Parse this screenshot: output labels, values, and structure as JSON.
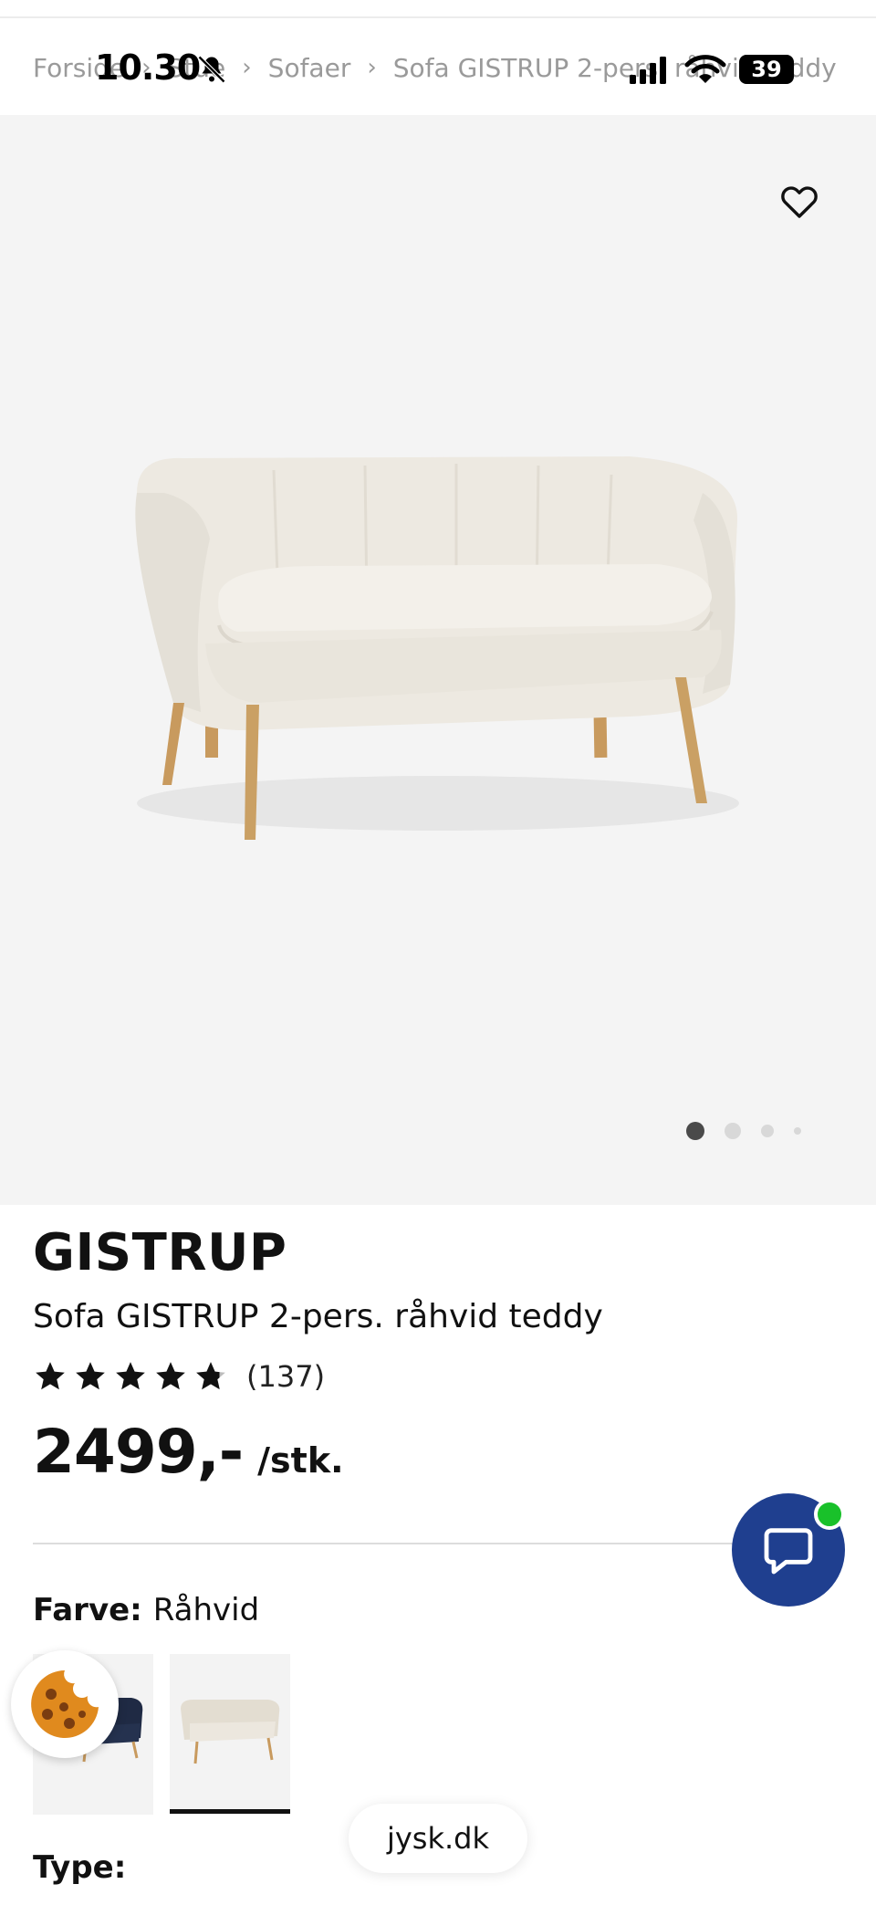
{
  "status_bar": {
    "time": "10.30",
    "battery": "39"
  },
  "breadcrumb": {
    "items": [
      "Forside",
      "Stue",
      "Sofaer",
      "Sofa GISTRUP 2-pers. råhvid teddy"
    ],
    "separator": "›"
  },
  "gallery": {
    "favorite_icon": "heart-outline-icon",
    "dots": 4,
    "active_dot": 0
  },
  "product": {
    "brand": "GISTRUP",
    "name": "Sofa GISTRUP 2-pers. råhvid teddy",
    "rating": 4.7,
    "rating_max": 5,
    "review_count": "(137)",
    "price": "2499,-",
    "price_unit": "/stk."
  },
  "options": {
    "color_label": "Farve:",
    "color_value": "Råhvid",
    "type_label": "Type:"
  },
  "browser": {
    "url": "jysk.dk"
  },
  "colors": {
    "chat_button": "#1f3f8f",
    "chat_online": "#19c12a",
    "hero_bg": "#f4f4f4"
  }
}
